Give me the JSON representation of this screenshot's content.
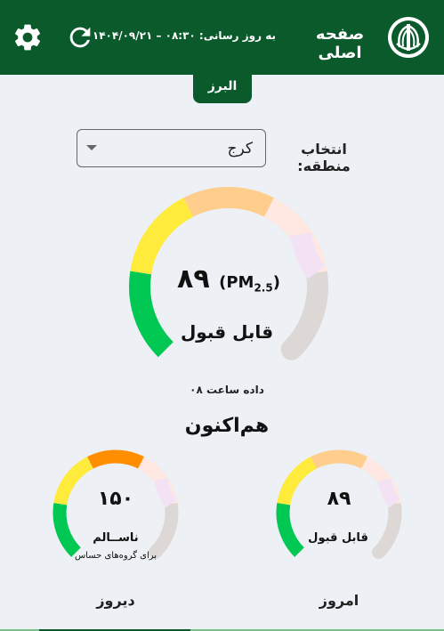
{
  "header": {
    "home_title": "صفحه اصلی",
    "updated_text": "به روز رسانی: ۰۸:۳۰ – ۱۴۰۴/۰۹/۲۱",
    "refresh_icon": "refresh-icon",
    "settings_icon": "gear-icon",
    "logo": "environment-logo"
  },
  "region_tab": "البرز",
  "region_select": {
    "label": "انتخاب منطقه:",
    "value": "کرج"
  },
  "current": {
    "value": "۸۹",
    "unit": "PM",
    "unit_sub": "2.5",
    "status": "قابل قبول",
    "data_hour": "داده ساعت ۰۸",
    "label": "هم‌اکنون",
    "level": 0.2
  },
  "yesterday": {
    "value": "۱۵۰",
    "status": "ناســالم",
    "note": "برای گروه‌های حساس",
    "label": "دیروز",
    "level": 0.4
  },
  "today": {
    "value": "۸۹",
    "status": "قابل قبول",
    "label": "امروز",
    "level": 0.2
  },
  "colors": {
    "header": "#0a5a2b",
    "good": "#00c853",
    "moderate": "#ffeb3b",
    "sensitive": "#ff8f00",
    "unhealthy": "#ffccbc",
    "very_unhealthy": "#e1bee7",
    "track": "#ddd8d6"
  }
}
